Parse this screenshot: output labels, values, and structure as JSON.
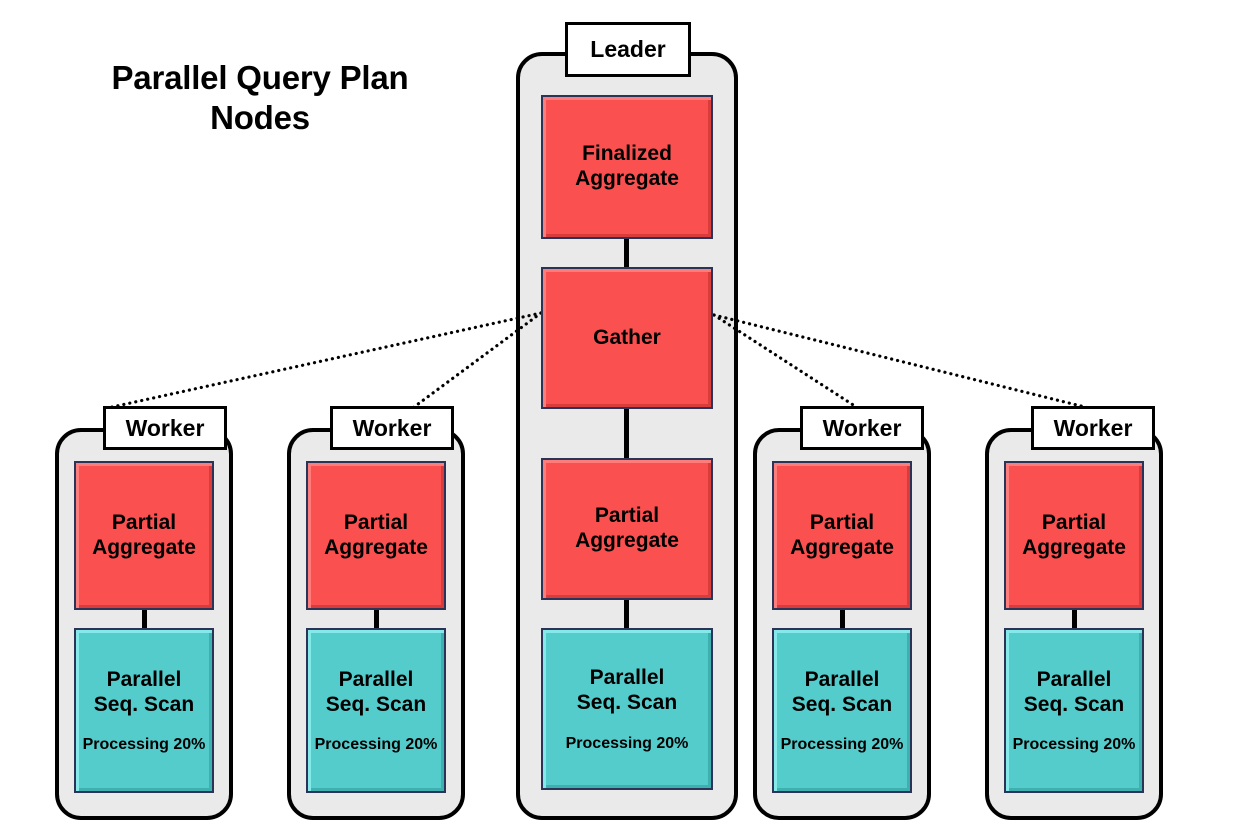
{
  "title": "Parallel Query Plan\nNodes",
  "colors": {
    "red_node": "#FA5050",
    "teal_node": "#54CCCC",
    "group_background": "#EAEAEA",
    "border": "#000000",
    "node_border": "#2B3356",
    "canvas": "#FFFFFF"
  },
  "leader": {
    "label": "Leader",
    "nodes": [
      {
        "label": "Finalized\nAggregate",
        "color": "red"
      },
      {
        "label": "Gather",
        "color": "red"
      },
      {
        "label": "Partial\nAggregate",
        "color": "red"
      },
      {
        "label": "Parallel\nSeq. Scan",
        "color": "teal",
        "status": "Processing 20%"
      }
    ]
  },
  "workers": [
    {
      "label": "Worker",
      "nodes": [
        {
          "label": "Partial\nAggregate",
          "color": "red"
        },
        {
          "label": "Parallel\nSeq. Scan",
          "color": "teal",
          "status": "Processing 20%"
        }
      ]
    },
    {
      "label": "Worker",
      "nodes": [
        {
          "label": "Partial\nAggregate",
          "color": "red"
        },
        {
          "label": "Parallel\nSeq. Scan",
          "color": "teal",
          "status": "Processing 20%"
        }
      ]
    },
    {
      "label": "Worker",
      "nodes": [
        {
          "label": "Partial\nAggregate",
          "color": "red"
        },
        {
          "label": "Parallel\nSeq. Scan",
          "color": "teal",
          "status": "Processing 20%"
        }
      ]
    },
    {
      "label": "Worker",
      "nodes": [
        {
          "label": "Partial\nAggregate",
          "color": "red"
        },
        {
          "label": "Parallel\nSeq. Scan",
          "color": "teal",
          "status": "Processing 20%"
        }
      ]
    }
  ]
}
